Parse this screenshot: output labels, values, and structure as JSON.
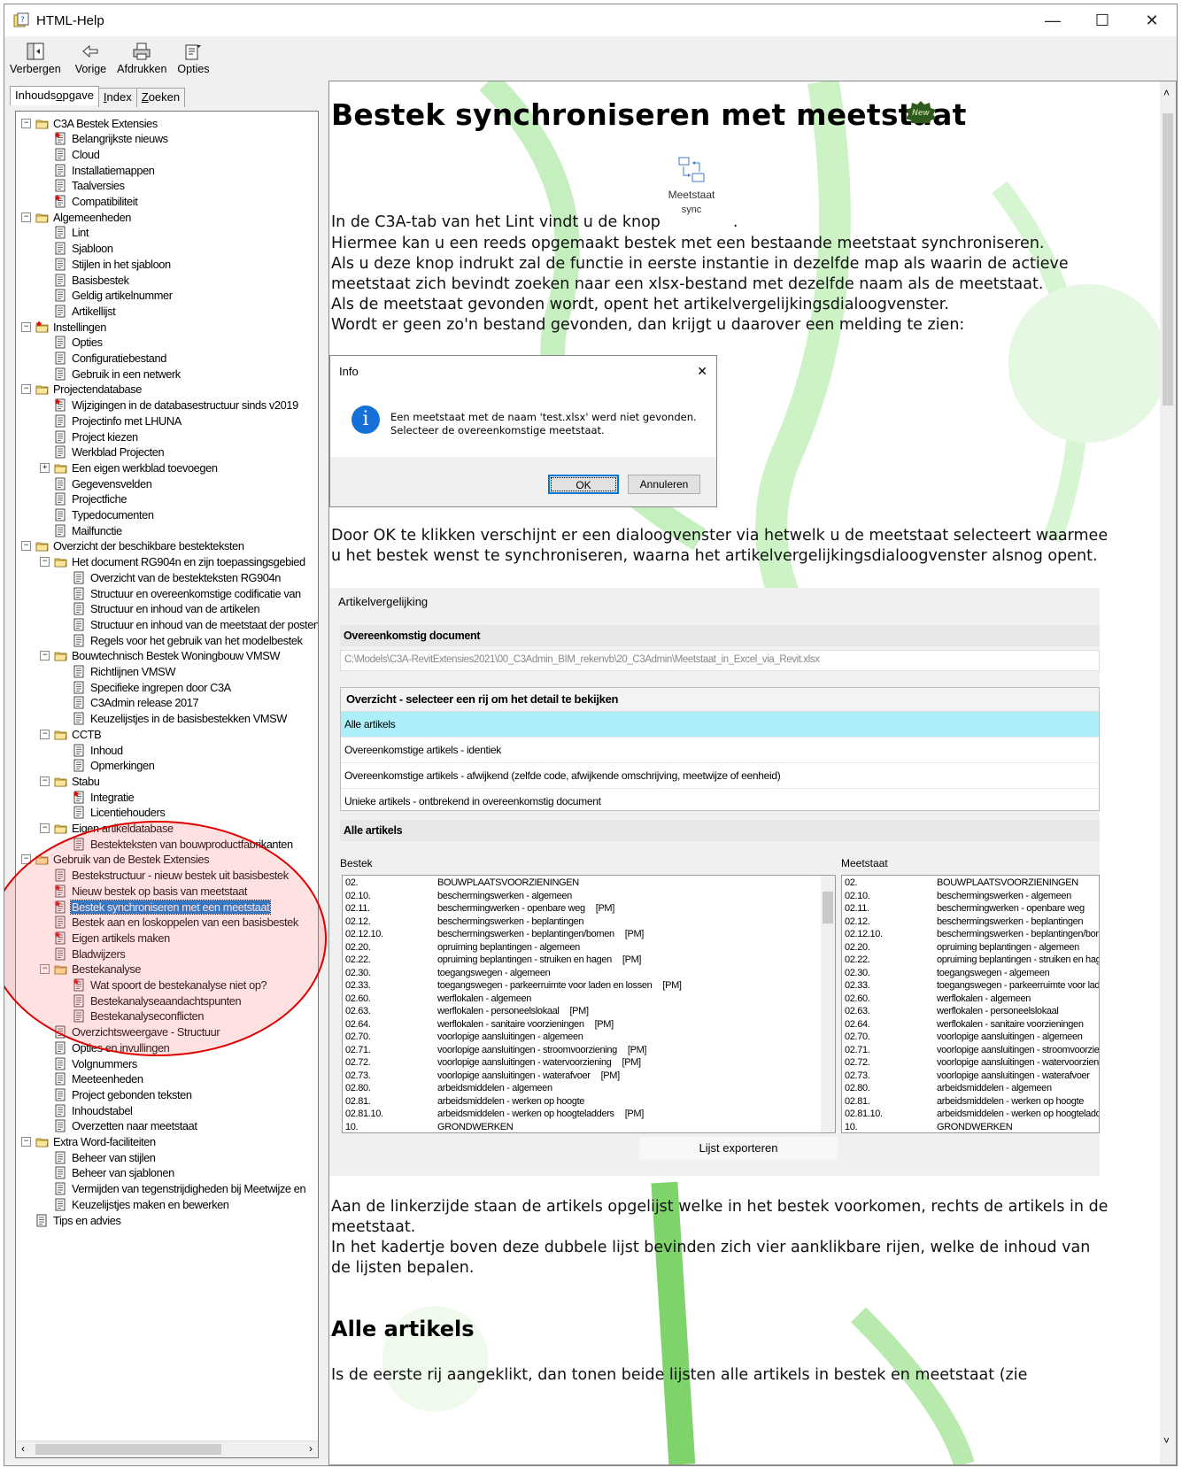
{
  "window": {
    "title": "HTML-Help",
    "controls": {
      "minimize": "—",
      "maximize": "☐",
      "close": "✕"
    }
  },
  "toolbar": {
    "hide_label": "Verbergen",
    "back_label": "Vorige",
    "print_label": "Afdrukken",
    "options_label": "Opties"
  },
  "tabs": {
    "contents_pre": "Inhouds",
    "contents_u": "o",
    "contents_post": "pgave",
    "index_pre": "",
    "index_u": "I",
    "index_post": "ndex",
    "search_pre": "",
    "search_u": "Z",
    "search_post": "oeken"
  },
  "tree": [
    {
      "label": "C3A Bestek Extensies",
      "level": 0,
      "type": "folder",
      "expander": "−"
    },
    {
      "label": "Belangrijkste nieuws",
      "level": 1,
      "type": "page",
      "isnew": true
    },
    {
      "label": "Cloud",
      "level": 1,
      "type": "page"
    },
    {
      "label": "Installatiemappen",
      "level": 1,
      "type": "page"
    },
    {
      "label": "Taalversies",
      "level": 1,
      "type": "page"
    },
    {
      "label": "Compatibiliteit",
      "level": 1,
      "type": "page",
      "isnew": true
    },
    {
      "label": "Algemeenheden",
      "level": 0,
      "type": "folder",
      "expander": "−"
    },
    {
      "label": "Lint",
      "level": 1,
      "type": "page"
    },
    {
      "label": "Sjabloon",
      "level": 1,
      "type": "page"
    },
    {
      "label": "Stijlen in het sjabloon",
      "level": 1,
      "type": "page"
    },
    {
      "label": "Basisbestek",
      "level": 1,
      "type": "page"
    },
    {
      "label": "Geldig artikelnummer",
      "level": 1,
      "type": "page"
    },
    {
      "label": "Artikellijst",
      "level": 1,
      "type": "page"
    },
    {
      "label": "Instellingen",
      "level": 0,
      "type": "folder",
      "expander": "−",
      "isnew": true
    },
    {
      "label": "Opties",
      "level": 1,
      "type": "page"
    },
    {
      "label": "Configuratiebestand",
      "level": 1,
      "type": "page"
    },
    {
      "label": "Gebruik in een netwerk",
      "level": 1,
      "type": "page"
    },
    {
      "label": "Projectendatabase",
      "level": 0,
      "type": "folder",
      "expander": "−"
    },
    {
      "label": "Wijzigingen in de databasestructuur sinds v2019",
      "level": 1,
      "type": "page",
      "isnew": true
    },
    {
      "label": "Projectinfo met LHUNA",
      "level": 1,
      "type": "page"
    },
    {
      "label": "Project kiezen",
      "level": 1,
      "type": "page"
    },
    {
      "label": "Werkblad Projecten",
      "level": 1,
      "type": "page"
    },
    {
      "label": "Een eigen werkblad toevoegen",
      "level": 1,
      "type": "folder",
      "expander": "+"
    },
    {
      "label": "Gegevensvelden",
      "level": 1,
      "type": "page"
    },
    {
      "label": "Projectfiche",
      "level": 1,
      "type": "page"
    },
    {
      "label": "Typedocumenten",
      "level": 1,
      "type": "page"
    },
    {
      "label": "Mailfunctie",
      "level": 1,
      "type": "page"
    },
    {
      "label": "Overzicht der beschikbare bestekteksten",
      "level": 0,
      "type": "folder",
      "expander": "−"
    },
    {
      "label": "Het document RG904n en zijn toepassingsgebied",
      "level": 1,
      "type": "folder",
      "expander": "−"
    },
    {
      "label": "Overzicht van de bestekteksten RG904n",
      "level": 2,
      "type": "page"
    },
    {
      "label": "Structuur en overeenkomstige codificatie van",
      "level": 2,
      "type": "page"
    },
    {
      "label": "Structuur en inhoud van de artikelen",
      "level": 2,
      "type": "page"
    },
    {
      "label": "Structuur en inhoud van de meetstaat der posten",
      "level": 2,
      "type": "page"
    },
    {
      "label": "Regels voor het gebruik van het modelbestek",
      "level": 2,
      "type": "page"
    },
    {
      "label": "Bouwtechnisch Bestek Woningbouw VMSW",
      "level": 1,
      "type": "folder",
      "expander": "−"
    },
    {
      "label": "Richtlijnen VMSW",
      "level": 2,
      "type": "page"
    },
    {
      "label": "Specifieke ingrepen door C3A",
      "level": 2,
      "type": "page"
    },
    {
      "label": "C3Admin release 2017",
      "level": 2,
      "type": "page"
    },
    {
      "label": "Keuzelijstjes in de basisbestekken VMSW",
      "level": 2,
      "type": "page"
    },
    {
      "label": "CCTB",
      "level": 1,
      "type": "folder",
      "expander": "−"
    },
    {
      "label": "Inhoud",
      "level": 2,
      "type": "page"
    },
    {
      "label": "Opmerkingen",
      "level": 2,
      "type": "page"
    },
    {
      "label": "Stabu",
      "level": 1,
      "type": "folder",
      "expander": "−"
    },
    {
      "label": "Integratie",
      "level": 2,
      "type": "page",
      "isnew": true
    },
    {
      "label": "Licentiehouders",
      "level": 2,
      "type": "page"
    },
    {
      "label": "Eigen artikeldatabase",
      "level": 1,
      "type": "folder",
      "expander": "−"
    },
    {
      "label": "Bestekteksten van bouwproductfabrikanten",
      "level": 2,
      "type": "page"
    },
    {
      "label": "Gebruik van de Bestek Extensies",
      "level": 0,
      "type": "folder",
      "expander": "−"
    },
    {
      "label": "Bestekstructuur - nieuw bestek uit basisbestek",
      "level": 1,
      "type": "page"
    },
    {
      "label": "Nieuw bestek op basis van meetstaat",
      "level": 1,
      "type": "page",
      "isnew": true
    },
    {
      "label": "Bestek synchroniseren met een meetstaat",
      "level": 1,
      "type": "page",
      "isnew": true,
      "selected": true
    },
    {
      "label": "Bestek aan en loskoppelen van een basisbestek",
      "level": 1,
      "type": "page"
    },
    {
      "label": "Eigen artikels maken",
      "level": 1,
      "type": "page",
      "isnew": true
    },
    {
      "label": "Bladwijzers",
      "level": 1,
      "type": "page"
    },
    {
      "label": "Bestekanalyse",
      "level": 1,
      "type": "folder",
      "expander": "−"
    },
    {
      "label": "Wat spoort de bestekanalyse niet op?",
      "level": 2,
      "type": "page",
      "isnew": true
    },
    {
      "label": "Bestekanalyseaandachtspunten",
      "level": 2,
      "type": "page"
    },
    {
      "label": "Bestekanalyseconflicten",
      "level": 2,
      "type": "page"
    },
    {
      "label": "Overzichtsweergave - Structuur",
      "level": 1,
      "type": "page"
    },
    {
      "label": "Opties en invullingen",
      "level": 1,
      "type": "page"
    },
    {
      "label": "Volgnummers",
      "level": 1,
      "type": "page"
    },
    {
      "label": "Meeteenheden",
      "level": 1,
      "type": "page"
    },
    {
      "label": "Project gebonden teksten",
      "level": 1,
      "type": "page"
    },
    {
      "label": "Inhoudstabel",
      "level": 1,
      "type": "page"
    },
    {
      "label": "Overzetten naar meetstaat",
      "level": 1,
      "type": "page"
    },
    {
      "label": "Extra Word-faciliteiten",
      "level": 0,
      "type": "folder",
      "expander": "−"
    },
    {
      "label": "Beheer van stijlen",
      "level": 1,
      "type": "page"
    },
    {
      "label": "Beheer van sjablonen",
      "level": 1,
      "type": "page"
    },
    {
      "label": "Vermijden van tegenstrijdigheden bij Meetwijze en",
      "level": 1,
      "type": "page"
    },
    {
      "label": "Keuzelijstjes maken en bewerken",
      "level": 1,
      "type": "page"
    },
    {
      "label": "Tips en advies",
      "level": 0,
      "type": "page"
    }
  ],
  "content": {
    "title": "Bestek synchroniseren met meetstaat",
    "new_badge": "New",
    "ribbon_button_label_1": "Meetstaat",
    "ribbon_button_label_2": "sync",
    "p1a": "In de C3A-tab van het Lint vindt u de knop",
    "p1b": ".",
    "p2": "Hiermee kan u een reeds opgemaakt bestek met een bestaande meetstaat synchroniseren.",
    "p3": "Als u deze knop indrukt zal de functie in eerste instantie in dezelfde map als waarin de actieve",
    "p4": "meetstaat zich bevindt zoeken naar een xlsx-bestand met dezelfde naam als de meetstaat.",
    "p5": "Als de meetstaat gevonden wordt, opent het artikelvergelijkingsdialoogvenster.",
    "p6": "Wordt er geen zo'n bestand gevonden, dan krijgt u daarover een melding te zien:",
    "p7": "Door OK te klikken verschijnt er een dialoogvenster via hetwelk u de meetstaat selecteert waarmee",
    "p8": "u het bestek wenst te synchroniseren, waarna het artikelvergelijkingsdialoogvenster alsnog opent.",
    "p9": "Aan de linkerzijde staan de artikels opgelijst welke in het bestek voorkomen, rechts de artikels in de",
    "p10": "meetstaat.",
    "p11": "In het kadertje boven deze dubbele lijst bevinden zich vier aanklikbare rijen, welke de inhoud van",
    "p12": "de lijsten bepalen.",
    "h2": "Alle artikels",
    "p13": "Is de eerste rij aangeklikt, dan tonen beide lijsten alle artikels in bestek en meetstaat (zie"
  },
  "dialog": {
    "title": "Info",
    "close": "✕",
    "msg1": "Een meetstaat met de naam 'test.xlsx' werd niet gevonden.",
    "msg2": "Selecteer de overeenkomstige meetstaat.",
    "ok": "OK",
    "cancel": "Annuleren"
  },
  "artvgl": {
    "title": "Artikelvergelijking",
    "doc_header": "Overeenkomstig document",
    "doc_path": "C:\\Models\\C3A-RevitExtensies2021\\00_C3Admin_BIM_rekenvb\\20_C3Admin\\Meetstaat_in_Excel_via_Revit.xlsx",
    "overview_header": "Overzicht - selecteer een rij om het detail te bekijken",
    "overview_rows": [
      "Alle artikels",
      "Overeenkomstige artikels - identiek",
      "Overeenkomstige artikels - afwijkend (zelfde code, afwijkende omschrijving, meetwijze of eenheid)",
      "Unieke artikels - ontbrekend in overeenkomstig document"
    ],
    "all_header": "Alle artikels",
    "left_label": "Bestek",
    "right_label": "Meetstaat",
    "export": "Lijst exporteren",
    "rows": [
      {
        "code": "02.",
        "desc": "BOUWPLAATSVOORZIENINGEN",
        "pm": ""
      },
      {
        "code": "02.10.",
        "desc": "beschermingswerken - algemeen",
        "pm": ""
      },
      {
        "code": "02.11.",
        "desc": "beschermingwerken - openbare weg",
        "pm": "[PM]"
      },
      {
        "code": "02.12.",
        "desc": "beschermingswerken - beplantingen",
        "pm": ""
      },
      {
        "code": "02.12.10.",
        "desc": "beschermingswerken - beplantingen/bomen",
        "pm": "[PM]"
      },
      {
        "code": "02.20.",
        "desc": "opruiming beplantingen - algemeen",
        "pm": ""
      },
      {
        "code": "02.22.",
        "desc": "opruiming beplantingen - struiken en hagen",
        "pm": "[PM]"
      },
      {
        "code": "02.30.",
        "desc": "toegangswegen - algemeen",
        "pm": ""
      },
      {
        "code": "02.33.",
        "desc": "toegangswegen - parkeerruimte voor laden en lossen",
        "pm": "[PM]"
      },
      {
        "code": "02.60.",
        "desc": "werflokalen - algemeen",
        "pm": ""
      },
      {
        "code": "02.63.",
        "desc": "werflokalen - personeelslokaal",
        "pm": "[PM]"
      },
      {
        "code": "02.64.",
        "desc": "werflokalen - sanitaire voorzieningen",
        "pm": "[PM]"
      },
      {
        "code": "02.70.",
        "desc": "voorlopige aansluitingen - algemeen",
        "pm": ""
      },
      {
        "code": "02.71.",
        "desc": "voorlopige aansluitingen - stroomvoorziening",
        "pm": "[PM]"
      },
      {
        "code": "02.72.",
        "desc": "voorlopige aansluitingen - watervoorziening",
        "pm": "[PM]"
      },
      {
        "code": "02.73.",
        "desc": "voorlopige aansluitingen - waterafvoer",
        "pm": "[PM]"
      },
      {
        "code": "02.80.",
        "desc": "arbeidsmiddelen - algemeen",
        "pm": ""
      },
      {
        "code": "02.81.",
        "desc": "arbeidsmiddelen - werken op hoogte",
        "pm": ""
      },
      {
        "code": "02.81.10.",
        "desc": "arbeidsmiddelen - werken op hoogteladders",
        "pm": "[PM]"
      },
      {
        "code": "10.",
        "desc": "GRONDWERKEN",
        "pm": ""
      }
    ]
  },
  "colors": {
    "selection": "#0078d7",
    "accent_green": "#7dd86a",
    "annotation_red": "#e00000",
    "active_row": "#aeeef8"
  }
}
